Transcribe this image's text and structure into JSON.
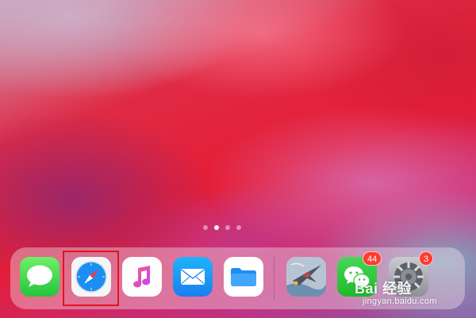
{
  "screen": {
    "type": "iPad home screen"
  },
  "page_indicator": {
    "page_count": 4,
    "current_page": 2
  },
  "dock": {
    "apps": [
      {
        "name": "Messages",
        "icon": "messages-icon"
      },
      {
        "name": "Safari",
        "icon": "safari-icon",
        "highlighted": true
      },
      {
        "name": "Music",
        "icon": "music-icon"
      },
      {
        "name": "Mail",
        "icon": "mail-icon"
      },
      {
        "name": "Files",
        "icon": "files-icon"
      },
      {
        "name": "Game",
        "icon": "fighter-jet-icon"
      },
      {
        "name": "WeChat",
        "icon": "wechat-icon",
        "badge": "44"
      },
      {
        "name": "Settings",
        "icon": "gear-icon",
        "badge": "3"
      }
    ]
  },
  "highlight": {
    "color": "#e2141e",
    "target": "Safari"
  },
  "watermark": {
    "logo_text": "Bai 经验",
    "url": "jingyan.baidu.com"
  }
}
